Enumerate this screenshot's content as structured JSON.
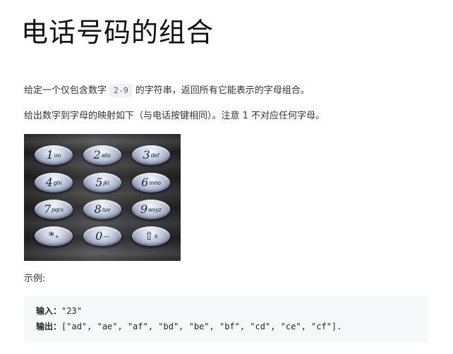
{
  "title": "电话号码的组合",
  "description": {
    "line1_before": "给定一个仅包含数字",
    "line1_code": "2-9",
    "line1_after": "的字符串，返回所有它能表示的字母组合。",
    "line2": "给出数字到字母的映射如下（与电话按键相同）。注意 1 不对应任何字母。"
  },
  "keypad": {
    "icon": "phone-keypad-image",
    "keys": [
      {
        "digit": "1",
        "letters": "oo"
      },
      {
        "digit": "2",
        "letters": "abc"
      },
      {
        "digit": "3",
        "letters": "def"
      },
      {
        "digit": "4",
        "letters": "ghi"
      },
      {
        "digit": "5",
        "letters": "jkl"
      },
      {
        "digit": "6",
        "letters": "mno"
      },
      {
        "digit": "7",
        "letters": "pqrs"
      },
      {
        "digit": "8",
        "letters": "tuv"
      },
      {
        "digit": "9",
        "letters": "wxyz"
      },
      {
        "digit": "*",
        "letters": "+"
      },
      {
        "digit": "0",
        "letters": "—"
      },
      {
        "digit": "⇧",
        "letters": "#"
      }
    ]
  },
  "example": {
    "label": "示例:",
    "input_label": "输入：",
    "input_value": "\"23\"",
    "output_label": "输出：",
    "output_value": "[\"ad\", \"ae\", \"af\", \"bd\", \"be\", \"bf\", \"cd\", \"ce\", \"cf\"]."
  },
  "colors": {
    "inline_code_bg": "#f0f1f4",
    "codeblock_bg": "#f7f8fa",
    "text": "#333333"
  }
}
